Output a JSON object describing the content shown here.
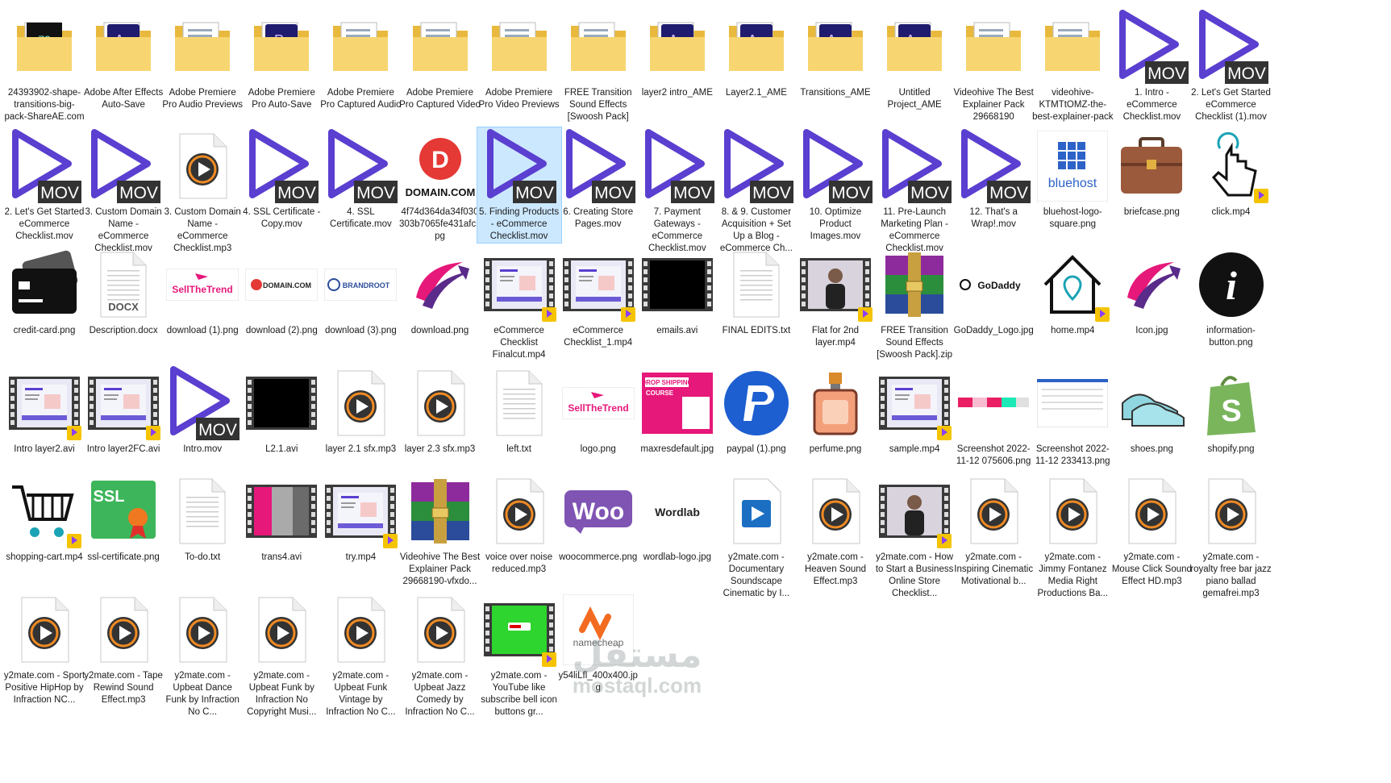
{
  "explorer": {
    "selected_index": 22,
    "items": [
      {
        "label": "24393902-shape-transitions-big-pack-ShareAE.com",
        "icon": "folder-ae-preview-icon"
      },
      {
        "label": "Adobe After Effects Auto-Save",
        "icon": "folder-after-effects-icon"
      },
      {
        "label": "Adobe Premiere Pro Audio Previews",
        "icon": "folder-icon"
      },
      {
        "label": "Adobe Premiere Pro Auto-Save",
        "icon": "folder-premiere-icon"
      },
      {
        "label": "Adobe Premiere Pro Captured Audio",
        "icon": "folder-icon"
      },
      {
        "label": "Adobe Premiere Pro Captured Video",
        "icon": "folder-icon"
      },
      {
        "label": "Adobe Premiere Pro Video Previews",
        "icon": "folder-icon"
      },
      {
        "label": "FREE Transition Sound Effects [Swoosh Pack]",
        "icon": "folder-icon"
      },
      {
        "label": "layer2 intro_AME",
        "icon": "folder-after-effects-icon"
      },
      {
        "label": "Layer2.1_AME",
        "icon": "folder-after-effects-icon"
      },
      {
        "label": "Transitions_AME",
        "icon": "folder-after-effects-icon"
      },
      {
        "label": "Untitled Project_AME",
        "icon": "folder-after-effects-icon"
      },
      {
        "label": "Videohive The Best Explainer Pack 29668190",
        "icon": "folder-icon"
      },
      {
        "label": "videohive-KTMTtOMZ-the-best-explainer-pack",
        "icon": "folder-icon"
      },
      {
        "label": "1. Intro - eCommerce Checklist.mov",
        "icon": "mov-file-icon"
      },
      {
        "label": "2. Let's Get Started eCommerce Checklist (1).mov",
        "icon": "mov-file-icon"
      },
      {
        "label": "2. Let's Get Started eCommerce Checklist.mov",
        "icon": "mov-file-icon"
      },
      {
        "label": "3. Custom Domain Name - eCommerce Checklist.mov",
        "icon": "mov-file-icon"
      },
      {
        "label": "3. Custom Domain Name - eCommerce Checklist.mp3",
        "icon": "audio-file-icon"
      },
      {
        "label": "4. SSL Certificate - Copy.mov",
        "icon": "mov-file-icon"
      },
      {
        "label": "4. SSL Certificate.mov",
        "icon": "mov-file-icon"
      },
      {
        "label": "4f74d364da34f030303b7065fe431afc.jpg",
        "icon": "domain-com-logo-icon"
      },
      {
        "label": "5. Finding Products - eCommerce Checklist.mov",
        "icon": "mov-file-icon"
      },
      {
        "label": "6. Creating Store Pages.mov",
        "icon": "mov-file-icon"
      },
      {
        "label": "7. Payment Gateways - eCommerce Checklist.mov",
        "icon": "mov-file-icon"
      },
      {
        "label": "8. & 9. Customer Acquisition + Set Up a Blog - eCommerce Ch...",
        "icon": "mov-file-icon"
      },
      {
        "label": "10. Optimize Product Images.mov",
        "icon": "mov-file-icon"
      },
      {
        "label": "11. Pre-Launch Marketing Plan - eCommerce Checklist.mov",
        "icon": "mov-file-icon"
      },
      {
        "label": "12. That's a Wrap!.mov",
        "icon": "mov-file-icon"
      },
      {
        "label": "bluehost-logo-square.png",
        "icon": "bluehost-logo-icon"
      },
      {
        "label": "briefcase.png",
        "icon": "briefcase-icon"
      },
      {
        "label": "click.mp4",
        "icon": "click-hand-icon"
      },
      {
        "label": "credit-card.png",
        "icon": "credit-card-icon"
      },
      {
        "label": "Description.docx",
        "icon": "docx-file-icon"
      },
      {
        "label": "download (1).png",
        "icon": "sell-the-trend-logo-icon"
      },
      {
        "label": "download (2).png",
        "icon": "domain-com-small-logo-icon"
      },
      {
        "label": "download (3).png",
        "icon": "brandroot-logo-icon"
      },
      {
        "label": "download.png",
        "icon": "sell-the-trend-mark-icon"
      },
      {
        "label": "eCommerce Checklist Finalcut.mp4",
        "icon": "video-thumbnail-icon"
      },
      {
        "label": "eCommerce Checklist_1.mp4",
        "icon": "video-thumbnail-icon"
      },
      {
        "label": "emails.avi",
        "icon": "black-video-icon"
      },
      {
        "label": "FINAL EDITS.txt",
        "icon": "text-file-icon"
      },
      {
        "label": "Flat for 2nd layer.mp4",
        "icon": "person-video-icon"
      },
      {
        "label": "FREE Transition Sound Effects [Swoosh Pack].zip",
        "icon": "winrar-archive-icon"
      },
      {
        "label": "GoDaddy_Logo.jpg",
        "icon": "godaddy-logo-icon"
      },
      {
        "label": "home.mp4",
        "icon": "home-pin-icon"
      },
      {
        "label": "Icon.jpg",
        "icon": "sell-the-trend-mark-icon"
      },
      {
        "label": "information-button.png",
        "icon": "info-icon"
      },
      {
        "label": "Intro layer2.avi",
        "icon": "video-thumbnail-icon"
      },
      {
        "label": "Intro layer2FC.avi",
        "icon": "video-thumbnail-icon"
      },
      {
        "label": "Intro.mov",
        "icon": "mov-file-icon"
      },
      {
        "label": "L2.1.avi",
        "icon": "black-video-icon"
      },
      {
        "label": "layer 2.1 sfx.mp3",
        "icon": "audio-file-icon"
      },
      {
        "label": "layer 2.3 sfx.mp3",
        "icon": "audio-file-icon"
      },
      {
        "label": "left.txt",
        "icon": "text-file-icon"
      },
      {
        "label": "logo.png",
        "icon": "sell-the-trend-logo-icon"
      },
      {
        "label": "maxresdefault.jpg",
        "icon": "drop-shipping-course-icon"
      },
      {
        "label": "paypal (1).png",
        "icon": "paypal-logo-icon"
      },
      {
        "label": "perfume.png",
        "icon": "perfume-icon"
      },
      {
        "label": "sample.mp4",
        "icon": "video-thumbnail-icon"
      },
      {
        "label": "Screenshot 2022-11-12 075606.png",
        "icon": "screenshot-colorbar-icon"
      },
      {
        "label": "Screenshot 2022-11-12 233413.png",
        "icon": "screenshot-page-icon"
      },
      {
        "label": "shoes.png",
        "icon": "shoes-icon"
      },
      {
        "label": "shopify.png",
        "icon": "shopify-logo-icon"
      },
      {
        "label": "shopping-cart.mp4",
        "icon": "shopping-cart-icon"
      },
      {
        "label": "ssl-certificate.png",
        "icon": "ssl-certificate-icon"
      },
      {
        "label": "To-do.txt",
        "icon": "text-file-icon"
      },
      {
        "label": "trans4.avi",
        "icon": "pink-video-icon"
      },
      {
        "label": "try.mp4",
        "icon": "video-thumbnail-icon"
      },
      {
        "label": "Videohive The Best Explainer Pack 29668190-vfxdo...",
        "icon": "winrar-archive-icon"
      },
      {
        "label": "voice over noise reduced.mp3",
        "icon": "audio-file-icon"
      },
      {
        "label": "woocommerce.png",
        "icon": "woocommerce-logo-icon"
      },
      {
        "label": "wordlab-logo.jpg",
        "icon": "wordlab-logo-icon"
      },
      {
        "label": "y2mate.com - Documentary Soundscape Cinematic by I...",
        "icon": "media-player-icon"
      },
      {
        "label": "y2mate.com - Heaven Sound Effect.mp3",
        "icon": "audio-file-icon"
      },
      {
        "label": "y2mate.com - How to Start a Business Online Store Checklist...",
        "icon": "person-video-icon"
      },
      {
        "label": "y2mate.com - Inspiring Cinematic Motivational b...",
        "icon": "audio-file-icon"
      },
      {
        "label": "y2mate.com - Jimmy Fontanez Media Right Productions Ba...",
        "icon": "audio-file-icon"
      },
      {
        "label": "y2mate.com - Mouse Click Sound Effect HD.mp3",
        "icon": "audio-file-icon"
      },
      {
        "label": "y2mate.com - royalty free bar jazz piano ballad gemafrei.mp3",
        "icon": "audio-file-icon"
      },
      {
        "label": "y2mate.com - Sport Positive HipHop by Infraction NC...",
        "icon": "audio-file-icon"
      },
      {
        "label": "y2mate.com - Tape Rewind Sound Effect.mp3",
        "icon": "audio-file-icon"
      },
      {
        "label": "y2mate.com - Upbeat Dance Funk by Infraction No C...",
        "icon": "audio-file-icon"
      },
      {
        "label": "y2mate.com - Upbeat Funk by Infraction No Copyright Musi...",
        "icon": "audio-file-icon"
      },
      {
        "label": "y2mate.com - Upbeat Funk Vintage by Infraction No C...",
        "icon": "audio-file-icon"
      },
      {
        "label": "y2mate.com - Upbeat Jazz Comedy by Infraction No C...",
        "icon": "audio-file-icon"
      },
      {
        "label": "y2mate.com - YouTube like subscribe bell icon buttons gr...",
        "icon": "green-screen-video-icon"
      },
      {
        "label": "y54liLfl_400x400.jpg",
        "icon": "namecheap-logo-icon"
      }
    ]
  },
  "watermark": {
    "arabic": "مستقل",
    "latin": "mostaql.com"
  },
  "colors": {
    "selection": "#cce8ff",
    "mov_purple": "#5a3fd0",
    "folder": "#f2c94c",
    "badge": "#f5c400"
  }
}
